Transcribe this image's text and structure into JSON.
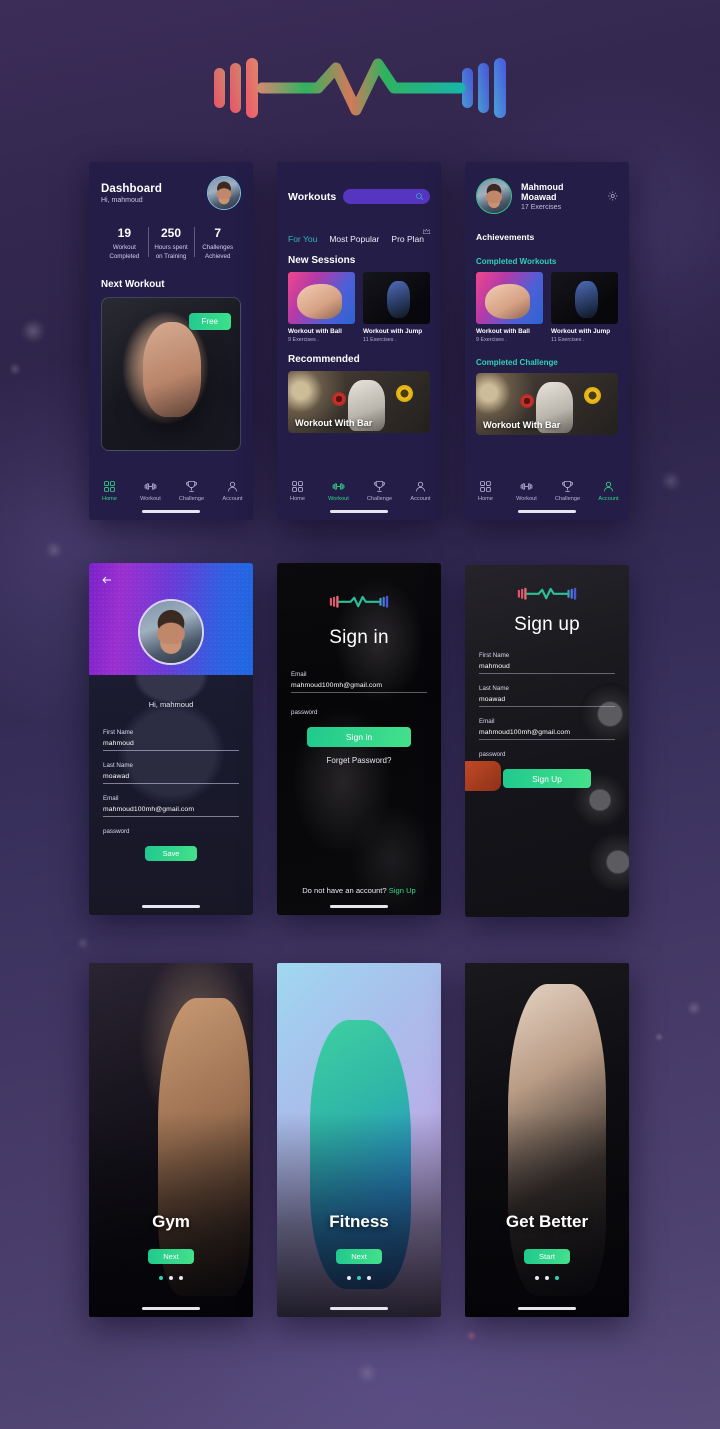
{
  "app": {
    "logo_name": "barbell-heartbeat-logo",
    "accent_green": "#2fd98a",
    "accent_teal": "#2fd0b6",
    "bg_purple": "#33274f"
  },
  "dashboard": {
    "title": "Dashboard",
    "greeting": "Hi, mahmoud",
    "avatar_name": "user-avatar",
    "stats": [
      {
        "value": "19",
        "label": "Workout\nCompleted",
        "l1": "Workout",
        "l2": "Completed"
      },
      {
        "value": "250",
        "label": "Hours spent on Training",
        "l1": "Hours spent",
        "l2": "on Training"
      },
      {
        "value": "7",
        "label": "Challenges Achieved",
        "l1": "Challenges",
        "l2": "Achieved"
      }
    ],
    "next_workout_title": "Next Workout",
    "free_badge": "Free"
  },
  "nav": {
    "items": [
      {
        "label": "Home",
        "icon": "grid-icon"
      },
      {
        "label": "Workout",
        "icon": "dumbbell-icon"
      },
      {
        "label": "Challenge",
        "icon": "trophy-icon"
      },
      {
        "label": "Account",
        "icon": "person-icon"
      }
    ],
    "active_dashboard": "Home",
    "active_workouts": "Workout",
    "active_profile": "Account"
  },
  "workouts": {
    "title": "Workouts",
    "search_placeholder": "",
    "search_icon": "search-icon",
    "tabs": [
      {
        "label": "For You",
        "active": true
      },
      {
        "label": "Most Popular",
        "active": false
      },
      {
        "label": "Pro Plan",
        "active": false,
        "badge_icon": "crown-icon"
      }
    ],
    "new_sessions_title": "New Sessions",
    "sessions": [
      {
        "title": "Workout with Ball",
        "subtitle": "9 Exercises ."
      },
      {
        "title": "Workout with Jump",
        "subtitle": "11 Exercises ."
      }
    ],
    "recommended_title": "Recommended",
    "recommended_card": "Workout With Bar"
  },
  "profile": {
    "name": "Mahmoud Moawad",
    "exercises": "17 Exercises",
    "settings_icon": "gear-icon",
    "achievements_title": "Achievements",
    "completed_workouts_title": "Completed Workouts",
    "completed_challenge_title": "Completed Challenge",
    "workouts": [
      {
        "title": "Workout with Ball",
        "subtitle": "9 Exercises ."
      },
      {
        "title": "Workout with Jump",
        "subtitle": "11 Exercises ."
      }
    ],
    "challenge_card": "Workout With Bar"
  },
  "edit_profile": {
    "back_icon": "back-arrow-icon",
    "greeting": "Hi, mahmoud",
    "fields": [
      {
        "label": "First Name",
        "value": "mahmoud"
      },
      {
        "label": "Last Name",
        "value": "moawad"
      },
      {
        "label": "Email",
        "value": "mahmoud100mh@gmail.com"
      },
      {
        "label": "password",
        "value": "●●●●●●●●●●●"
      }
    ],
    "save_label": "Save"
  },
  "sign_in": {
    "title": "Sign in",
    "fields": [
      {
        "label": "Email",
        "value": "mahmoud100mh@gmail.com"
      },
      {
        "label": "password",
        "value": "●●●●●●●●●●●"
      }
    ],
    "submit_label": "Sign in",
    "forgot_label": "Forget Password?",
    "no_account_text": "Do not have an account?",
    "sign_up_link": "Sign Up"
  },
  "sign_up": {
    "title": "Sign up",
    "fields": [
      {
        "label": "First Name",
        "value": "mahmoud"
      },
      {
        "label": "Last Name",
        "value": "moawad"
      },
      {
        "label": "Email",
        "value": "mahmoud100mh@gmail.com"
      },
      {
        "label": "password",
        "value": "●●●●●●●●●●●"
      }
    ],
    "submit_label": "Sign Up"
  },
  "onboarding": [
    {
      "title": "Gym",
      "button": "Next",
      "active_dot": 0
    },
    {
      "title": "Fitness",
      "button": "Next",
      "active_dot": 1
    },
    {
      "title": "Get Better",
      "button": "Start",
      "active_dot": 2
    }
  ]
}
